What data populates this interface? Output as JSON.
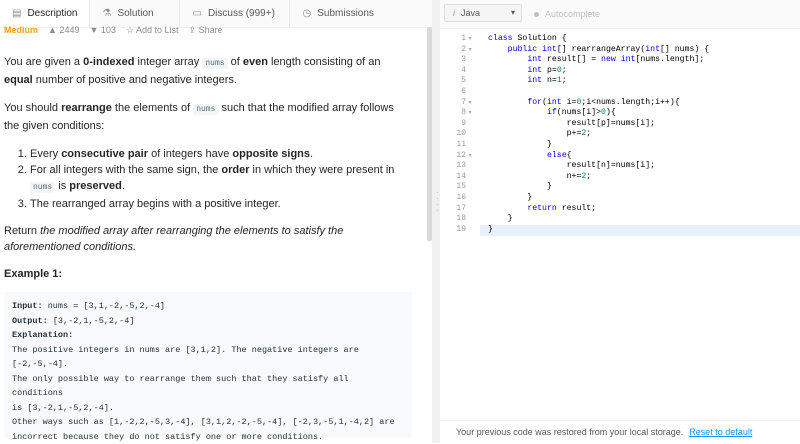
{
  "tabs": [
    {
      "icon": "document-icon",
      "label": "Description"
    },
    {
      "icon": "flask-icon",
      "label": "Solution"
    },
    {
      "icon": "chat-icon",
      "label": "Discuss (999+)"
    },
    {
      "icon": "clock-icon",
      "label": "Submissions"
    }
  ],
  "meta": {
    "difficulty": "Medium",
    "likes": "2449",
    "dislikes": "103",
    "add_to_list": "Add to List",
    "share": "Share"
  },
  "description": {
    "p1_a": "You are given a ",
    "p1_b": "0-indexed",
    "p1_c": " integer array ",
    "p1_code": "nums",
    "p1_d": " of ",
    "p1_e": "even",
    "p1_f": " length consisting of an ",
    "p1_g": "equal",
    "p1_h": " number of positive and negative integers.",
    "p2_a": "You should ",
    "p2_b": "rearrange",
    "p2_c": " the elements of ",
    "p2_code": "nums",
    "p2_d": " such that the modified array follows the given conditions:",
    "li1_a": "Every ",
    "li1_b": "consecutive pair",
    "li1_c": " of integers have ",
    "li1_d": "opposite signs",
    "li1_e": ".",
    "li2_a": "For all integers with the same sign, the ",
    "li2_b": "order",
    "li2_c": " in which they were present in ",
    "li2_code": "nums",
    "li2_d": " is ",
    "li2_e": "preserved",
    "li2_f": ".",
    "li3": "The rearranged array begins with a positive integer.",
    "p3_a": "Return ",
    "p3_b": "the modified array after rearranging the elements to satisfy the aforementioned conditions."
  },
  "example": {
    "title": "Example 1:",
    "input_label": "Input:",
    "input": " nums = [3,1,-2,-5,2,-4]",
    "output_label": "Output:",
    "output": " [3,-2,1,-5,2,-4]",
    "expl_label": "Explanation:",
    "expl": "The positive integers in nums are [3,1,2]. The negative integers are\n[-2,-5,-4].\nThe only possible way to rearrange them such that they satisfy all conditions\nis [3,-2,1,-5,2,-4].\nOther ways such as [1,-2,2,-5,3,-4], [3,1,2,-2,-5,-4], [-2,3,-5,1,-4,2] are\nincorrect because they do not satisfy one or more conditions."
  },
  "editor": {
    "language": "Java",
    "autocomplete": "Autocomplete",
    "lines": [
      {
        "n": "1",
        "fold": "▾"
      },
      {
        "n": "2",
        "fold": "▾"
      },
      {
        "n": "3",
        "fold": ""
      },
      {
        "n": "4",
        "fold": ""
      },
      {
        "n": "5",
        "fold": ""
      },
      {
        "n": "6",
        "fold": ""
      },
      {
        "n": "7",
        "fold": "▾"
      },
      {
        "n": "8",
        "fold": "▾"
      },
      {
        "n": "9",
        "fold": ""
      },
      {
        "n": "10",
        "fold": ""
      },
      {
        "n": "11",
        "fold": ""
      },
      {
        "n": "12",
        "fold": "▾"
      },
      {
        "n": "13",
        "fold": ""
      },
      {
        "n": "14",
        "fold": ""
      },
      {
        "n": "15",
        "fold": ""
      },
      {
        "n": "16",
        "fold": ""
      },
      {
        "n": "17",
        "fold": ""
      },
      {
        "n": "18",
        "fold": ""
      },
      {
        "n": "19",
        "fold": ""
      }
    ],
    "code": [
      "class Solution {",
      "    public int[] rearrangeArray(int[] nums) {",
      "        int result[] = new int[nums.length];",
      "        int p=0;",
      "        int n=1;",
      "",
      "        for(int i=0;i<nums.length;i++){",
      "            if(nums[i]>0){",
      "                result[p]=nums[i];",
      "                p+=2;",
      "            }",
      "            else{",
      "                result[n]=nums[i];",
      "                n+=2;",
      "            }",
      "        }",
      "        return result;",
      "    }",
      "}"
    ]
  },
  "footer": {
    "message": "Your previous code was restored from your local storage.",
    "link": "Reset to default"
  }
}
